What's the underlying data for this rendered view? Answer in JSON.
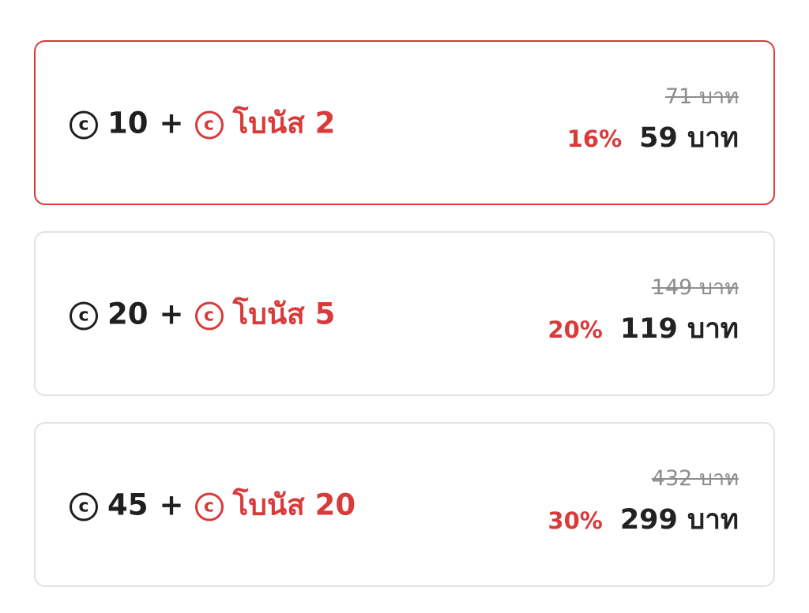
{
  "packages": [
    {
      "selected": true,
      "coins": "10",
      "plus": "+",
      "bonus_label": "โบนัส 2",
      "old_price": "71 บาท",
      "discount": "16%",
      "price": "59 บาท"
    },
    {
      "selected": false,
      "coins": "20",
      "plus": "+",
      "bonus_label": "โบนัส 5",
      "old_price": "149 บาท",
      "discount": "20%",
      "price": "119 บาท"
    },
    {
      "selected": false,
      "coins": "45",
      "plus": "+",
      "bonus_label": "โบนัส 20",
      "old_price": "432 บาท",
      "discount": "30%",
      "price": "299 บาท"
    }
  ],
  "icons": {
    "coin_icon": "coin-icon",
    "coin_glyph": "c"
  },
  "colors": {
    "accent": "#d93a3a",
    "text": "#1f1f1f",
    "strikethrough": "#8d8d8d",
    "card_border": "#e2e2e2"
  }
}
